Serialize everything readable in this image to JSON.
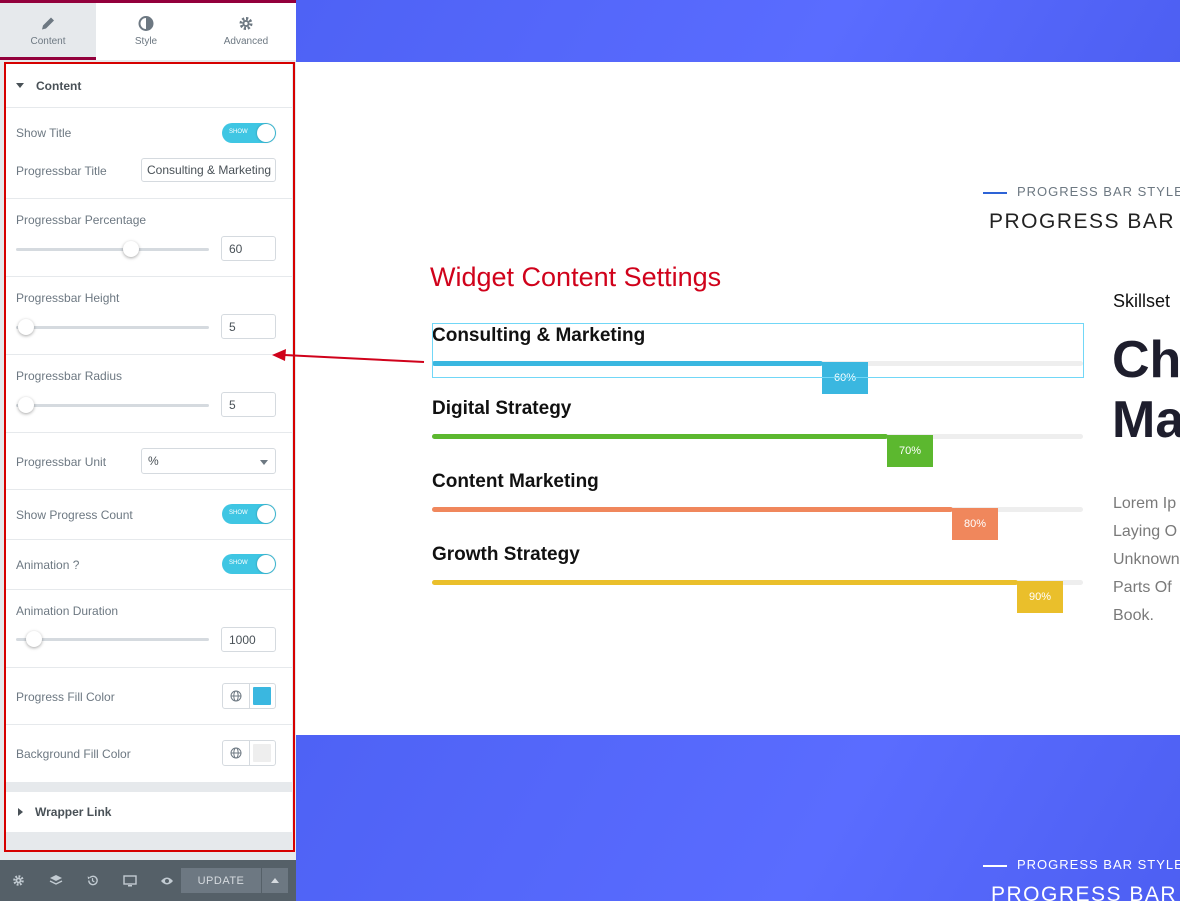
{
  "panel": {
    "tabs": [
      {
        "label": "Content",
        "icon": "pencil-icon"
      },
      {
        "label": "Style",
        "icon": "half-circle-icon"
      },
      {
        "label": "Advanced",
        "icon": "gear-icon"
      }
    ],
    "section_title": "Content",
    "controls": {
      "show_title": {
        "label": "Show Title",
        "toggle": "SHOW"
      },
      "progressbar_title": {
        "label": "Progressbar Title",
        "value": "Consulting & Marketing"
      },
      "progressbar_percentage": {
        "label": "Progressbar Percentage",
        "value": "60"
      },
      "progressbar_height": {
        "label": "Progressbar Height",
        "value": "5"
      },
      "progressbar_radius": {
        "label": "Progressbar Radius",
        "value": "5"
      },
      "progressbar_unit": {
        "label": "Progressbar Unit",
        "value": "%"
      },
      "show_progress_count": {
        "label": "Show Progress Count",
        "toggle": "SHOW"
      },
      "animation": {
        "label": "Animation ?",
        "toggle": "SHOW"
      },
      "animation_duration": {
        "label": "Animation Duration",
        "value": "1000"
      },
      "progress_fill_color": {
        "label": "Progress Fill Color",
        "color": "#3ab7e0"
      },
      "background_fill_color": {
        "label": "Background Fill Color",
        "color": "#eeeeee"
      }
    },
    "wrapper_link": "Wrapper Link",
    "update_label": "UPDATE"
  },
  "preview": {
    "subtitle_top": "PROGRESS BAR STYLE",
    "heading_top": "PROGRESS BAR (",
    "annotation": "Widget Content Settings",
    "bars": [
      {
        "title": "Consulting & Marketing",
        "percent": 60,
        "label": "60%",
        "color": "#3ab7e0"
      },
      {
        "title": "Digital Strategy",
        "percent": 70,
        "label": "70%",
        "color": "#5cb82f"
      },
      {
        "title": "Content Marketing",
        "percent": 80,
        "label": "80%",
        "color": "#f0875c"
      },
      {
        "title": "Growth Strategy",
        "percent": 90,
        "label": "90%",
        "color": "#eabf2b"
      }
    ],
    "skillset": "Skillset",
    "big_line1": "Ch",
    "big_line2": "Ma",
    "lorem": [
      "Lorem Ip",
      "Laying O",
      "Unknown",
      "Parts Of",
      "Book."
    ],
    "subtitle_bottom": "PROGRESS BAR STYLE",
    "heading_bottom": "PROGRESS BAR ("
  }
}
